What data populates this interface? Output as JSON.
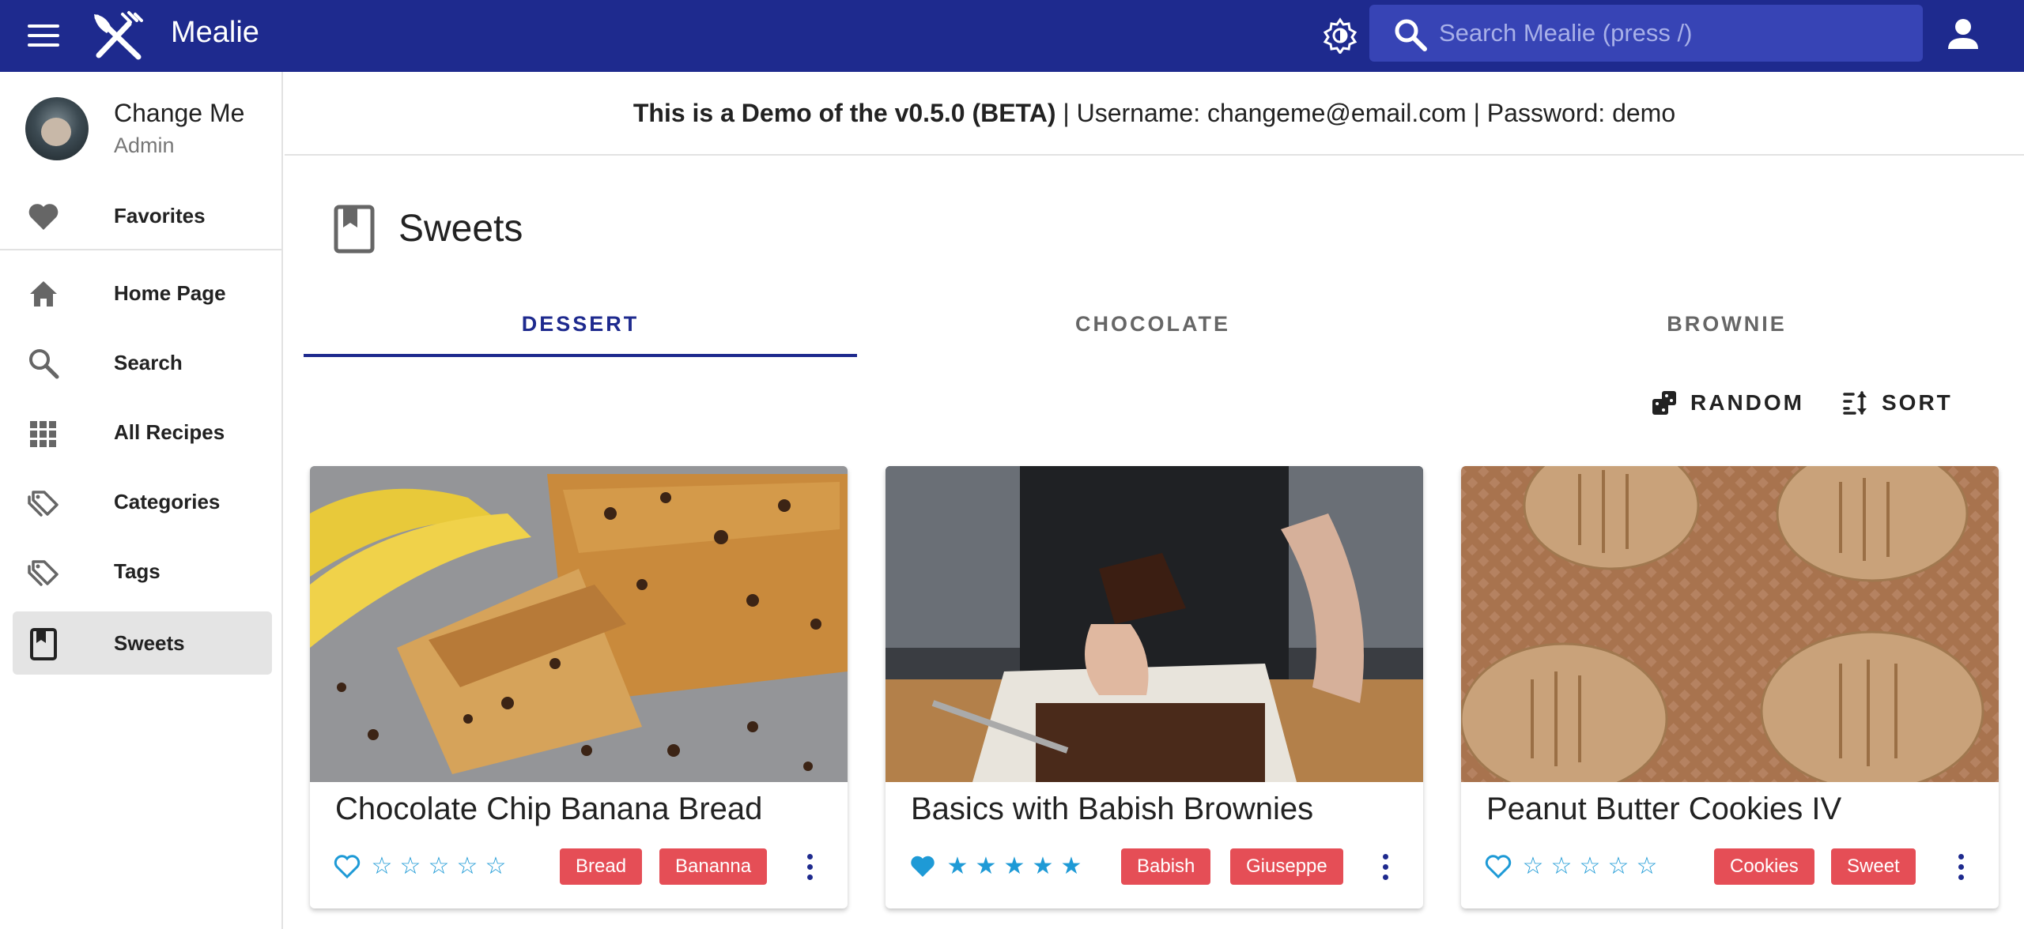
{
  "app": {
    "title": "Mealie",
    "brand_color": "#1e2a8e"
  },
  "search": {
    "placeholder": "Search Mealie (press /)"
  },
  "profile": {
    "name": "Change Me",
    "role": "Admin"
  },
  "sidebar": {
    "items": [
      {
        "label": "Favorites",
        "icon": "heart-icon"
      },
      {
        "label": "Home Page",
        "icon": "home-icon"
      },
      {
        "label": "Search",
        "icon": "search-icon"
      },
      {
        "label": "All Recipes",
        "icon": "grid-icon"
      },
      {
        "label": "Categories",
        "icon": "tag-multiple-icon"
      },
      {
        "label": "Tags",
        "icon": "tag-multiple-icon"
      },
      {
        "label": "Sweets",
        "icon": "bookmark-book-icon"
      }
    ]
  },
  "banner": {
    "bold": "This is a Demo of the v0.5.0 (BETA)",
    "rest": " | Username: changeme@email.com | Password: demo"
  },
  "page": {
    "title": "Sweets"
  },
  "tabs": [
    {
      "label": "DESSERT",
      "active": true
    },
    {
      "label": "CHOCOLATE",
      "active": false
    },
    {
      "label": "BROWNIE",
      "active": false
    }
  ],
  "actions": {
    "random_label": "RANDOM",
    "sort_label": "SORT"
  },
  "recipes": [
    {
      "title": "Chocolate Chip Banana Bread",
      "favorite": false,
      "rating": 0,
      "tags": [
        "Bread",
        "Bananna"
      ]
    },
    {
      "title": "Basics with Babish Brownies",
      "favorite": true,
      "rating": 5,
      "tags": [
        "Babish",
        "Giuseppe"
      ]
    },
    {
      "title": "Peanut Butter Cookies IV",
      "favorite": false,
      "rating": 0,
      "tags": [
        "Cookies",
        "Sweet"
      ]
    }
  ]
}
